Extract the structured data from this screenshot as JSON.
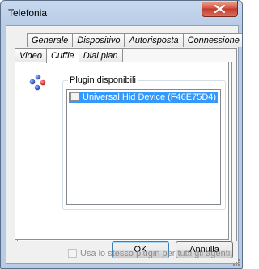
{
  "window": {
    "title": "Telefonia"
  },
  "tabs_back": [
    "Generale",
    "Dispositivo",
    "Autorisposta",
    "Connessione"
  ],
  "tabs_front": [
    "Video",
    "Cuffie",
    "Dial plan"
  ],
  "active_tab": "Cuffie",
  "plugins": {
    "label": "Plugin disponibili",
    "items": [
      {
        "label": "Universal Hid Device (F46E75D4)",
        "checked": false,
        "selected": true
      }
    ]
  },
  "same_plugin": {
    "label": "Usa lo stesso plugin per tutti gli agenti.",
    "checked": false,
    "enabled": false
  },
  "buttons": {
    "ok": "OK",
    "cancel": "Annulla"
  },
  "colors": {
    "selection": "#3399ff",
    "close_button": "#c0392b",
    "icon_blue": "#2b4fbf",
    "icon_red": "#d42a2a"
  }
}
